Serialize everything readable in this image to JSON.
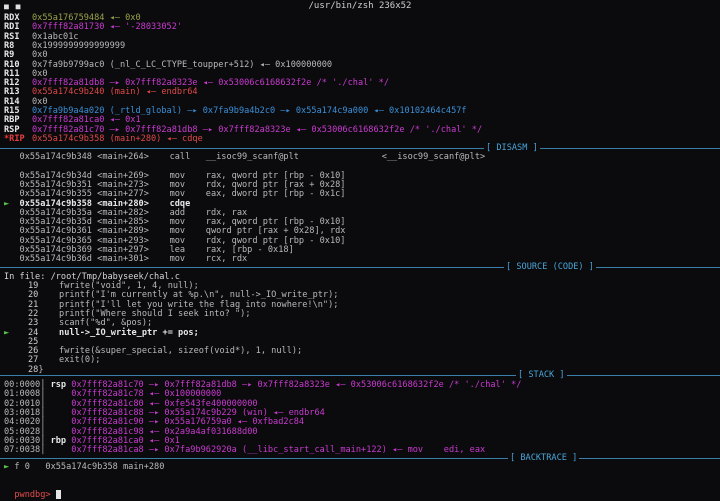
{
  "title": "/usr/bin/zsh 236x52",
  "titlebar_marks": "■ ■",
  "registers": [
    {
      "name": "RDX",
      "rest": "0x55a176759484 ◂— 0x0",
      "cls": "heap"
    },
    {
      "name": "RDI",
      "rest": "0x7fff82a81730 ◂— '-28033052'",
      "cls": "stk"
    },
    {
      "name": "RSI",
      "rest": "0x1abc01c",
      "cls": ""
    },
    {
      "name": "R8",
      "rest": "0x1999999999999999",
      "cls": ""
    },
    {
      "name": "R9",
      "rest": "0x0",
      "cls": ""
    },
    {
      "name": "R10",
      "rest": "0x7fa9b9799ac0 (_nl_C_LC_CTYPE_toupper+512) ◂— 0x100000000",
      "cls": ""
    },
    {
      "name": "R11",
      "rest": "0x0",
      "cls": ""
    },
    {
      "name": "R12",
      "rest": "0x7fff82a81db8 —▸ 0x7fff82a8323e ◂— 0x53006c6168632f2e /* './chal' */",
      "cls": "stk"
    },
    {
      "name": "R13",
      "rest": "0x55a174c9b240 (main) ◂— endbr64",
      "cls": "code"
    },
    {
      "name": "R14",
      "rest": "0x0",
      "cls": ""
    },
    {
      "name": "R15",
      "rest": "0x7fa9b9a4a020 (_rtld_global) —▸ 0x7fa9b9a4b2c0 —▸ 0x55a174c9a000 ◂— 0x10102464c457f",
      "cls": "addr"
    },
    {
      "name": "RBP",
      "rest": "0x7fff82a81ca0 ◂— 0x1",
      "cls": "stk"
    },
    {
      "name": "RSP",
      "rest": "0x7fff82a81c70 —▸ 0x7fff82a81db8 —▸ 0x7fff82a8323e ◂— 0x53006c6168632f2e /* './chal' */",
      "cls": "stk"
    },
    {
      "name": "*RIP",
      "rest": "0x55a174c9b358 (main+280) ◂— cdqe",
      "cls": "code",
      "red": true
    }
  ],
  "sections": {
    "disasm": "[ DISASM ]",
    "source": "[ SOURCE (CODE) ]",
    "stack": "[ STACK ]",
    "backtrace": "[ BACKTRACE ]"
  },
  "disasm": [
    {
      "m": "",
      "t": "0x55a174c9b348 <main+264>    call   __isoc99_scanf@plt                <__isoc99_scanf@plt>"
    },
    {
      "m": "",
      "t": ""
    },
    {
      "m": "",
      "t": "0x55a174c9b34d <main+269>    mov    rax, qword ptr [rbp - 0x10]"
    },
    {
      "m": "",
      "t": "0x55a174c9b351 <main+273>    mov    rdx, qword ptr [rax + 0x28]"
    },
    {
      "m": "",
      "t": "0x55a174c9b355 <main+277>    mov    eax, dword ptr [rbp - 0x1c]"
    },
    {
      "m": "►",
      "t": "0x55a174c9b358 <main+280>    cdqe",
      "cur": true
    },
    {
      "m": "",
      "t": "0x55a174c9b35a <main+282>    add    rdx, rax"
    },
    {
      "m": "",
      "t": "0x55a174c9b35d <main+285>    mov    rax, qword ptr [rbp - 0x10]"
    },
    {
      "m": "",
      "t": "0x55a174c9b361 <main+289>    mov    qword ptr [rax + 0x28], rdx"
    },
    {
      "m": "",
      "t": "0x55a174c9b365 <main+293>    mov    rdx, qword ptr [rbp - 0x10]"
    },
    {
      "m": "",
      "t": "0x55a174c9b369 <main+297>    lea    rax, [rbp - 0x18]"
    },
    {
      "m": "",
      "t": "0x55a174c9b36d <main+301>    mov    rcx, rdx"
    }
  ],
  "source_file": "In file: /root/Tmp/babyseek/chal.c",
  "source": [
    {
      "m": "",
      "n": "19",
      "t": "    fwrite(\"void\", 1, 4, null);"
    },
    {
      "m": "",
      "n": "20",
      "t": "    printf(\"I'm currently at %p.\\n\", null->_IO_write_ptr);"
    },
    {
      "m": "",
      "n": "21",
      "t": "    printf(\"I'll let you write the flag into nowhere!\\n\");"
    },
    {
      "m": "",
      "n": "22",
      "t": "    printf(\"Where should I seek into? \");"
    },
    {
      "m": "",
      "n": "23",
      "t": "    scanf(\"%d\", &pos);"
    },
    {
      "m": "►",
      "n": "24",
      "t": "    null->_IO_write_ptr += pos;",
      "cur": true
    },
    {
      "m": "",
      "n": "25",
      "t": ""
    },
    {
      "m": "",
      "n": "26",
      "t": "    fwrite(&super_special, sizeof(void*), 1, null);"
    },
    {
      "m": "",
      "n": "27",
      "t": "    exit(0);"
    },
    {
      "m": "",
      "n": "28",
      "t": "}"
    }
  ],
  "stack": [
    {
      "off": "00:0000│",
      "reg": "rsp",
      "t": "0x7fff82a81c70 —▸ 0x7fff82a81db8 —▸ 0x7fff82a8323e ◂— 0x53006c6168632f2e /* './chal' */"
    },
    {
      "off": "01:0008│",
      "reg": "   ",
      "t": "0x7fff82a81c78 ◂— 0x100000000"
    },
    {
      "off": "02:0010│",
      "reg": "   ",
      "t": "0x7fff82a81c80 ◂— 0xfe543fe400000000"
    },
    {
      "off": "03:0018│",
      "reg": "   ",
      "t": "0x7fff82a81c88 —▸ 0x55a174c9b229 (win) ◂— endbr64"
    },
    {
      "off": "04:0020│",
      "reg": "   ",
      "t": "0x7fff82a81c90 —▸ 0x55a176759a0 ◂— 0xfbad2c84"
    },
    {
      "off": "05:0028│",
      "reg": "   ",
      "t": "0x7fff82a81c98 ◂— 0x2a9a4af031688d00"
    },
    {
      "off": "06:0030│",
      "reg": "rbp",
      "t": "0x7fff82a81ca0 ◂— 0x1"
    },
    {
      "off": "07:0038│",
      "reg": "   ",
      "t": "0x7fff82a81ca8 —▸ 0x7fa9b962920a (__libc_start_call_main+122) ◂— mov    edi, eax"
    }
  ],
  "backtrace": [
    {
      "m": "►",
      "t": "f 0   0x55a174c9b358 main+280"
    }
  ],
  "prompt": "pwndbg> "
}
